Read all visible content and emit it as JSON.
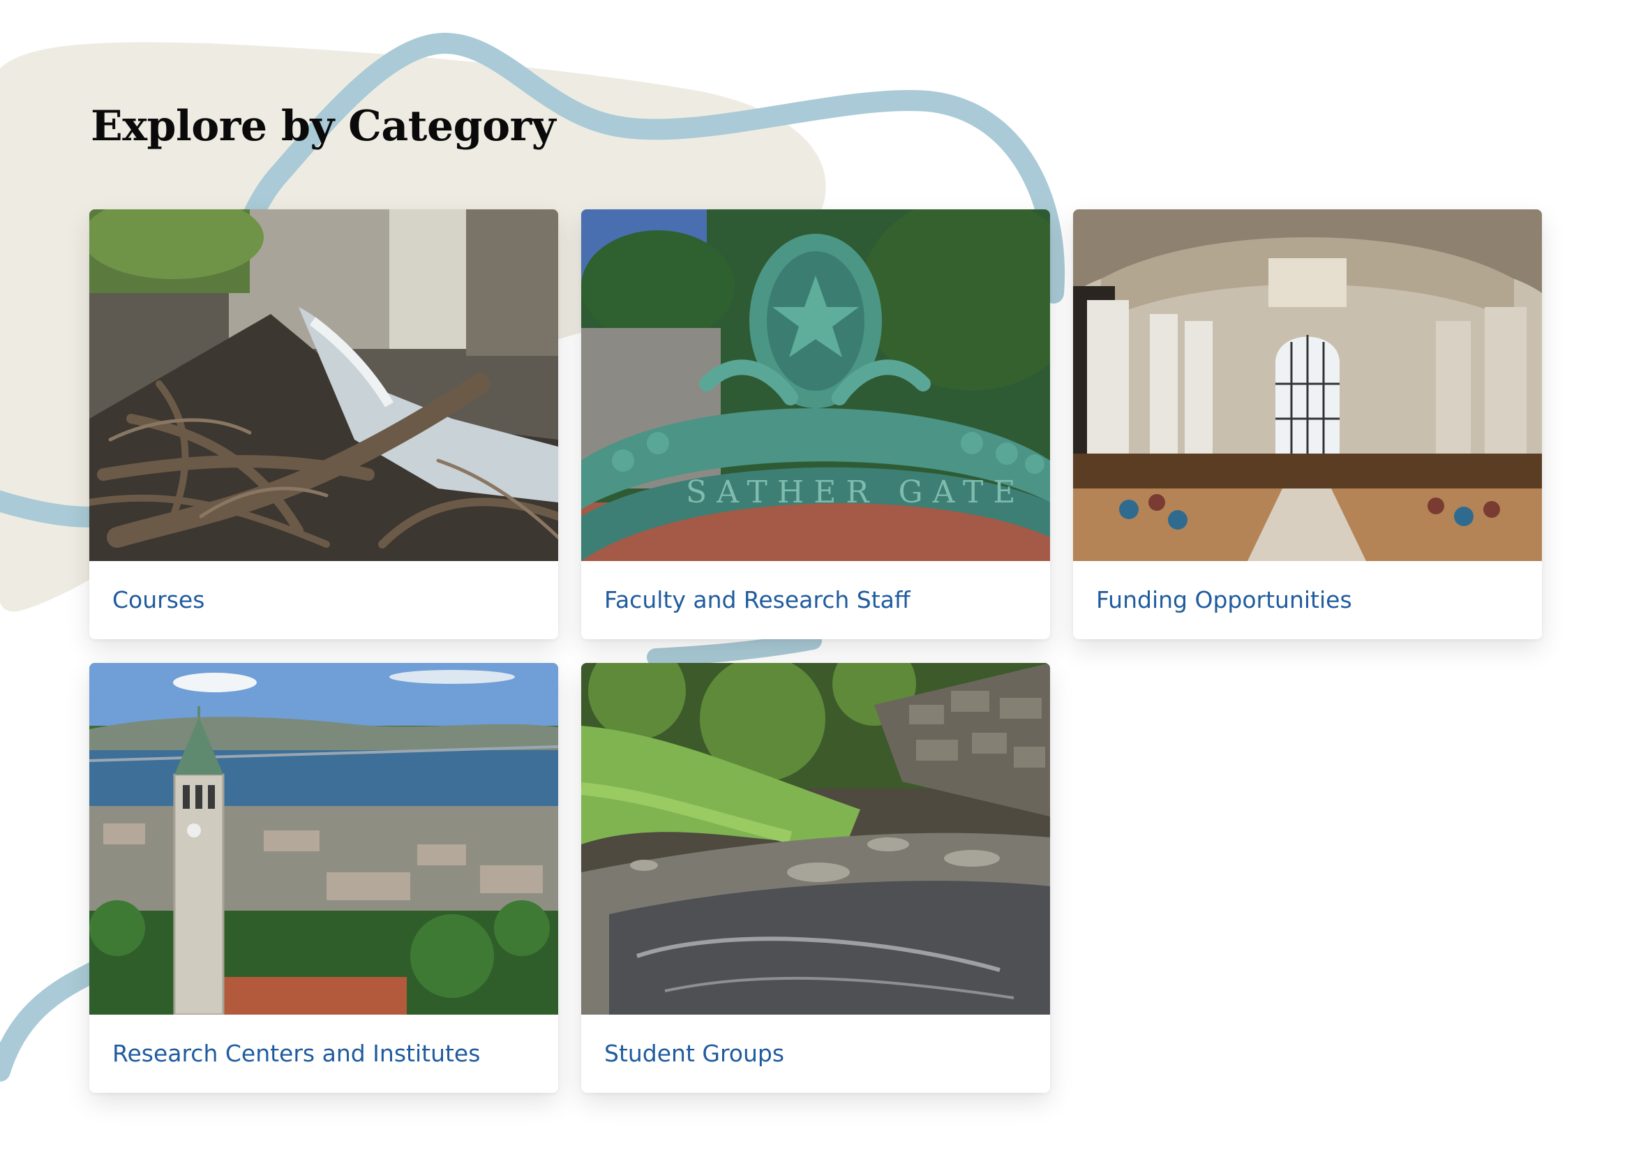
{
  "page": {
    "heading": "Explore by Category"
  },
  "colors": {
    "heading": "#0a0a0a",
    "link": "#1f5b9e",
    "blob": "#eeece2",
    "ribbon": "#a9cad6"
  },
  "categories": [
    {
      "label": "Courses",
      "image": "creek-with-roots-photo"
    },
    {
      "label": "Faculty and Research Staff",
      "image": "sather-gate-photo"
    },
    {
      "label": "Funding Opportunities",
      "image": "library-reading-room-photo"
    },
    {
      "label": "Research Centers and Institutes",
      "image": "campanile-bay-view-photo"
    },
    {
      "label": "Student Groups",
      "image": "stream-stone-wall-photo"
    }
  ]
}
